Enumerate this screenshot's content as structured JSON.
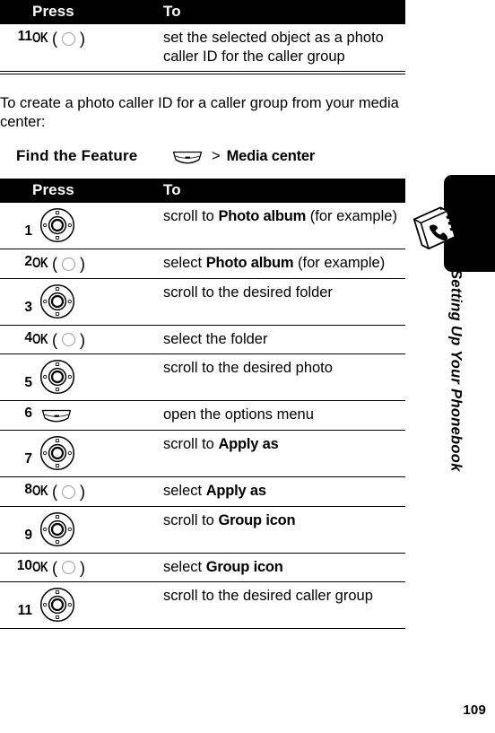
{
  "page": {
    "number": "109",
    "section_title": "Setting Up Your Phonebook",
    "book_icon": "phonebook-icon"
  },
  "table_top": {
    "headers": {
      "num": "",
      "press": "Press",
      "to": "To"
    },
    "rows": [
      {
        "num": "11",
        "press_type": "ok-key",
        "press_label": "OK",
        "to_parts": [
          {
            "text": "set the selected object as a photo caller ID for the caller group",
            "bold": false
          }
        ]
      }
    ]
  },
  "intro": {
    "text": "To create a photo caller ID for a caller group from your media center:"
  },
  "find_the_feature": {
    "label": "Find the Feature",
    "key_icon": "menu-key-icon",
    "separator": ">",
    "destination": "Media center"
  },
  "table_main": {
    "headers": {
      "num": "",
      "press": "Press",
      "to": "To"
    },
    "rows": [
      {
        "num": "1",
        "press_type": "nav-wheel",
        "press_label": "",
        "to_parts": [
          {
            "text": "scroll to ",
            "bold": false
          },
          {
            "text": "Photo album",
            "bold": true
          },
          {
            "text": " (for example)",
            "bold": false
          }
        ]
      },
      {
        "num": "2",
        "press_type": "ok-key",
        "press_label": "OK",
        "to_parts": [
          {
            "text": "select ",
            "bold": false
          },
          {
            "text": "Photo album",
            "bold": true
          },
          {
            "text": " (for example)",
            "bold": false
          }
        ]
      },
      {
        "num": "3",
        "press_type": "nav-wheel",
        "press_label": "",
        "to_parts": [
          {
            "text": "scroll to the desired folder",
            "bold": false
          }
        ]
      },
      {
        "num": "4",
        "press_type": "ok-key",
        "press_label": "OK",
        "to_parts": [
          {
            "text": "select the folder",
            "bold": false
          }
        ]
      },
      {
        "num": "5",
        "press_type": "nav-wheel",
        "press_label": "",
        "to_parts": [
          {
            "text": "scroll to the desired photo",
            "bold": false
          }
        ]
      },
      {
        "num": "6",
        "press_type": "menu-key",
        "press_label": "",
        "to_parts": [
          {
            "text": "open the options menu",
            "bold": false
          }
        ]
      },
      {
        "num": "7",
        "press_type": "nav-wheel",
        "press_label": "",
        "to_parts": [
          {
            "text": "scroll to ",
            "bold": false
          },
          {
            "text": "Apply as",
            "bold": true
          }
        ]
      },
      {
        "num": "8",
        "press_type": "ok-key",
        "press_label": "OK",
        "to_parts": [
          {
            "text": "select ",
            "bold": false
          },
          {
            "text": "Apply as",
            "bold": true
          }
        ]
      },
      {
        "num": "9",
        "press_type": "nav-wheel",
        "press_label": "",
        "to_parts": [
          {
            "text": "scroll to ",
            "bold": false
          },
          {
            "text": "Group icon",
            "bold": true
          }
        ]
      },
      {
        "num": "10",
        "press_type": "ok-key",
        "press_label": "OK",
        "to_parts": [
          {
            "text": "select ",
            "bold": false
          },
          {
            "text": "Group icon",
            "bold": true
          }
        ]
      },
      {
        "num": "11",
        "press_type": "nav-wheel",
        "press_label": "",
        "to_parts": [
          {
            "text": "scroll to the desired caller group",
            "bold": false
          }
        ]
      }
    ]
  },
  "colors": {
    "header_bg": "#000000",
    "header_fg": "#ffffff",
    "rule": "#000000",
    "page_bg": "#ffffff"
  }
}
